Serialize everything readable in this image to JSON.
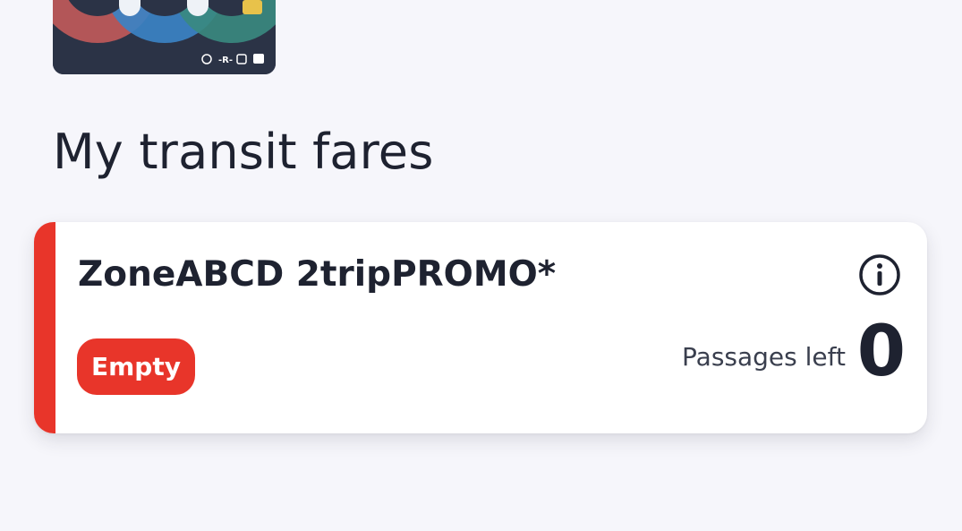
{
  "header": {
    "title": "My transit fares"
  },
  "transit_card": {
    "image": "opus-transit-card",
    "mode_icons": [
      "metro-icon",
      "train-icon",
      "tram-icon",
      "bus-icon"
    ],
    "colors": {
      "background": "#2b3346",
      "red": "#c25a5a",
      "blue": "#3b82c4",
      "green": "#3a8a80",
      "chip": "#e8c24a"
    }
  },
  "fare": {
    "name": "ZoneABCD 2tripPROMO*",
    "status_badge": "Empty",
    "passages_label": "Passages left",
    "passages_count": "0",
    "info_icon": "info-icon"
  },
  "colors": {
    "accent": "#e8352a",
    "text": "#1e2230",
    "background": "#f6f6fb"
  }
}
